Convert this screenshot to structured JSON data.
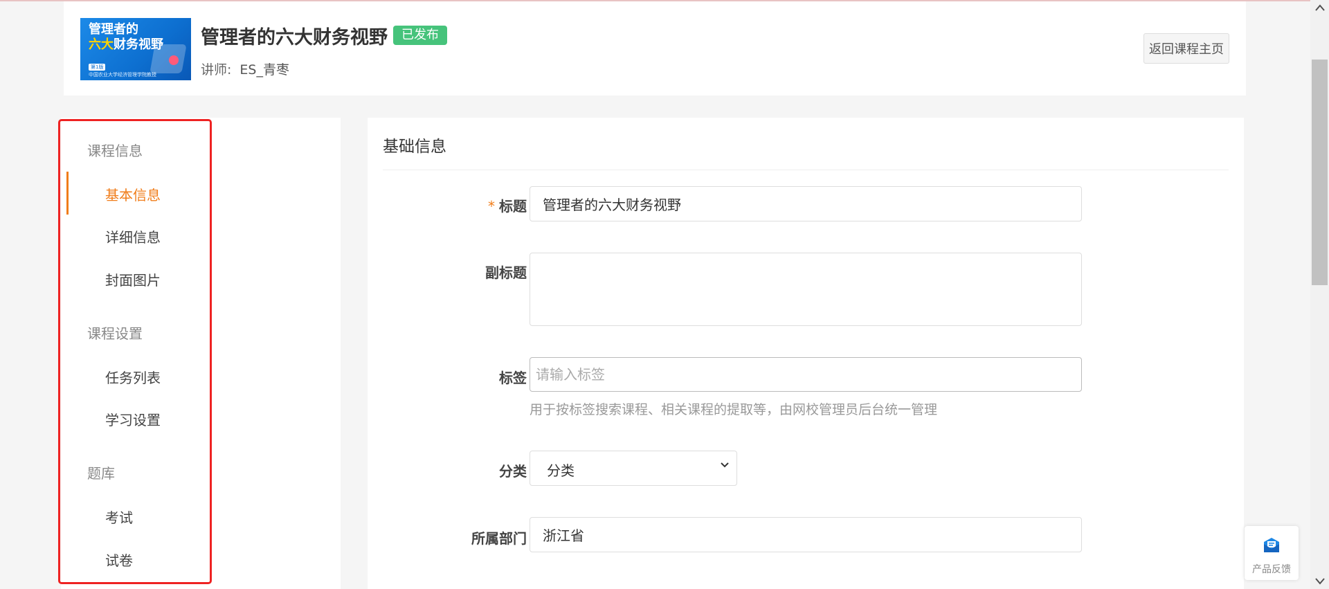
{
  "header": {
    "cover": {
      "line1": "管理者的",
      "line2_yellow": "六大",
      "line2_white": "财务视野",
      "tag": "第1版",
      "footer": "中国农业大学经济管理学院教授"
    },
    "course_title": "管理者的六大财务视野",
    "status_badge": "已发布",
    "instructor_label": "讲师:",
    "instructor_name": "ES_青枣",
    "back_button": "返回课程主页"
  },
  "sidebar": {
    "groups": [
      {
        "title": "课程信息",
        "items": [
          "基本信息",
          "详细信息",
          "封面图片"
        ]
      },
      {
        "title": "课程设置",
        "items": [
          "任务列表",
          "学习设置"
        ]
      },
      {
        "title": "题库",
        "items": [
          "考试",
          "试卷"
        ]
      }
    ],
    "active_item": "基本信息"
  },
  "main": {
    "section_title": "基础信息",
    "fields": {
      "title": {
        "label": "标题",
        "required_mark": "*",
        "value": "管理者的六大财务视野"
      },
      "subtitle": {
        "label": "副标题",
        "value": ""
      },
      "tags": {
        "label": "标签",
        "placeholder": "请输入标签",
        "help": "用于按标签搜索课程、相关课程的提取等，由网校管理员后台统一管理"
      },
      "category": {
        "label": "分类",
        "value": "分类"
      },
      "department": {
        "label": "所属部门",
        "value": "浙江省"
      }
    }
  },
  "feedback": {
    "label": "产品反馈"
  },
  "colors": {
    "accent": "#f07d1a",
    "badge_green": "#46c37b",
    "highlight_red": "#ee2222"
  }
}
